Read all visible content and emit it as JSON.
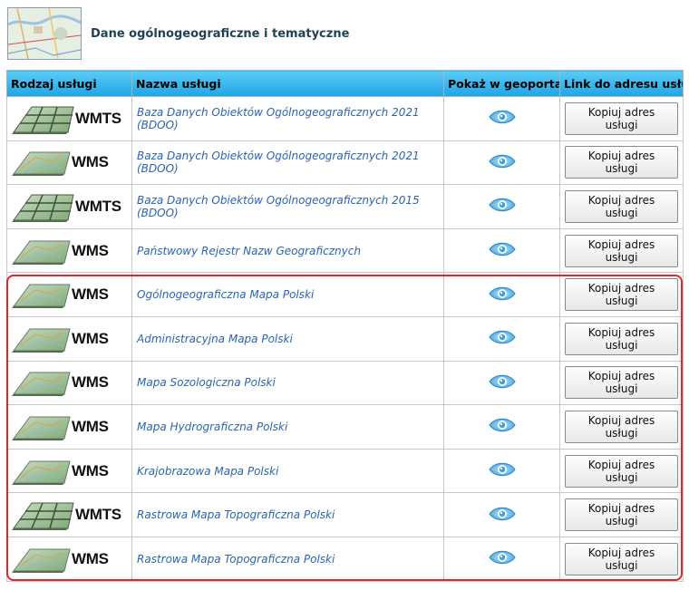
{
  "header": {
    "title": "Dane ogólnogeograficzne i tematyczne",
    "thumbnail_icon": "topographic-map-thumbnail"
  },
  "table": {
    "columns": [
      "Rodzaj usługi",
      "Nazwa usługi",
      "Pokaż w geoportalu",
      "Link do adresu usługi"
    ],
    "rows": [
      {
        "type": "WMTS",
        "name": "Baza Danych Obiektów Ogólnogeograficznych 2021 (BDOO)",
        "button": "Kopiuj adres usługi"
      },
      {
        "type": "WMS",
        "name": "Baza Danych Obiektów Ogólnogeograficznych 2021 (BDOO)",
        "button": "Kopiuj adres usługi"
      },
      {
        "type": "WMTS",
        "name": "Baza Danych Obiektów Ogólnogeograficznych 2015 (BDOO)",
        "button": "Kopiuj adres usługi"
      },
      {
        "type": "WMS",
        "name": "Państwowy Rejestr Nazw Geograficznych",
        "button": "Kopiuj adres usługi"
      },
      {
        "type": "WMS",
        "name": "Ogólnogeograficzna Mapa Polski",
        "button": "Kopiuj adres usługi"
      },
      {
        "type": "WMS",
        "name": "Administracyjna Mapa Polski",
        "button": "Kopiuj adres usługi"
      },
      {
        "type": "WMS",
        "name": "Mapa Sozologiczna Polski",
        "button": "Kopiuj adres usługi"
      },
      {
        "type": "WMS",
        "name": "Mapa Hydrograficzna Polski",
        "button": "Kopiuj adres usługi"
      },
      {
        "type": "WMS",
        "name": "Krajobrazowa Mapa Polski",
        "button": "Kopiuj adres usługi"
      },
      {
        "type": "WMTS",
        "name": "Rastrowa Mapa Topograficzna Polski",
        "button": "Kopiuj adres usługi"
      },
      {
        "type": "WMS",
        "name": "Rastrowa Mapa Topograficzna Polski",
        "button": "Kopiuj adres usługi"
      }
    ]
  },
  "icons": {
    "show": "eye-icon",
    "wms": "wms-map-layer-icon",
    "wmts": "wmts-tile-grid-icon"
  },
  "colors": {
    "header_gradient_top": "#5ccaf5",
    "header_gradient_bottom": "#1ea6e6",
    "link_text": "#2a64b4",
    "highlight_border": "#e2262a",
    "eye_blue": "#3aa0dc"
  }
}
